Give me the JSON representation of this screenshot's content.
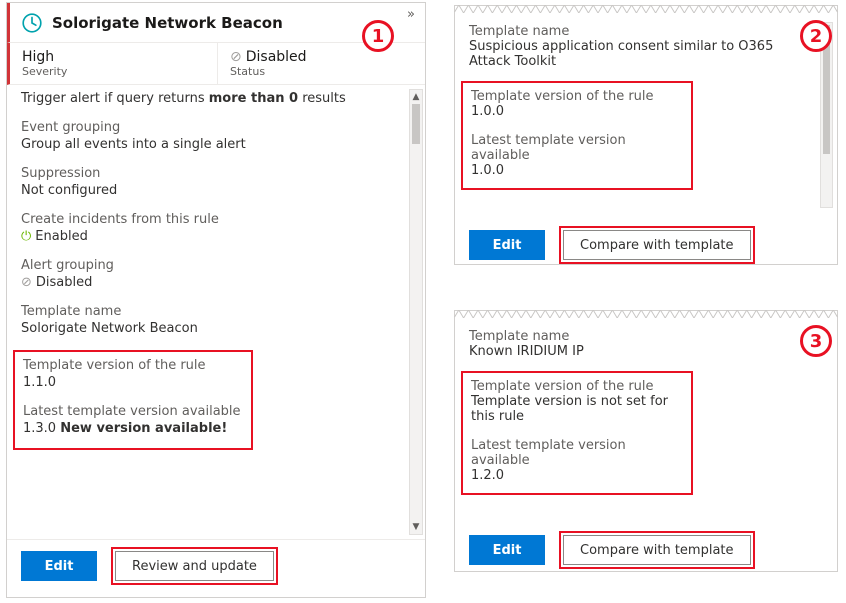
{
  "panel1": {
    "title": "Solorigate Network Beacon",
    "severity_value": "High",
    "severity_label": "Severity",
    "status_value": "Disabled",
    "status_label": "Status",
    "trigger_pre": "Trigger alert if query returns ",
    "trigger_bold": "more than 0",
    "trigger_post": " results",
    "event_grouping_label": "Event grouping",
    "event_grouping_value": "Group all events into a single alert",
    "suppression_label": "Suppression",
    "suppression_value": "Not configured",
    "incidents_label": "Create incidents from this rule",
    "incidents_value": "Enabled",
    "alert_grp_label": "Alert grouping",
    "alert_grp_value": "Disabled",
    "tmpl_name_label": "Template name",
    "tmpl_name_value": "Solorigate Network Beacon",
    "rule_ver_label": "Template version of the rule",
    "rule_ver_value": "1.1.0",
    "latest_label": "Latest template version available",
    "latest_prefix": "1.3.0 ",
    "latest_bold": "New version available!",
    "edit_btn": "Edit",
    "review_btn": "Review and update"
  },
  "panel2": {
    "tmpl_name_label": "Template name",
    "tmpl_name_value": "Suspicious application consent similar to O365 Attack Toolkit",
    "rule_ver_label": "Template version of the rule",
    "rule_ver_value": "1.0.0",
    "latest_label": "Latest template version available",
    "latest_value": "1.0.0",
    "edit_btn": "Edit",
    "compare_btn": "Compare with template"
  },
  "panel3": {
    "tmpl_name_label": "Template name",
    "tmpl_name_value": "Known IRIDIUM IP",
    "rule_ver_label": "Template version of the rule",
    "rule_ver_value": "Template version is not set for this rule",
    "latest_label": "Latest template version available",
    "latest_value": "1.2.0",
    "edit_btn": "Edit",
    "compare_btn": "Compare with template"
  },
  "callouts": {
    "n1": "1",
    "n2": "2",
    "n3": "3"
  }
}
